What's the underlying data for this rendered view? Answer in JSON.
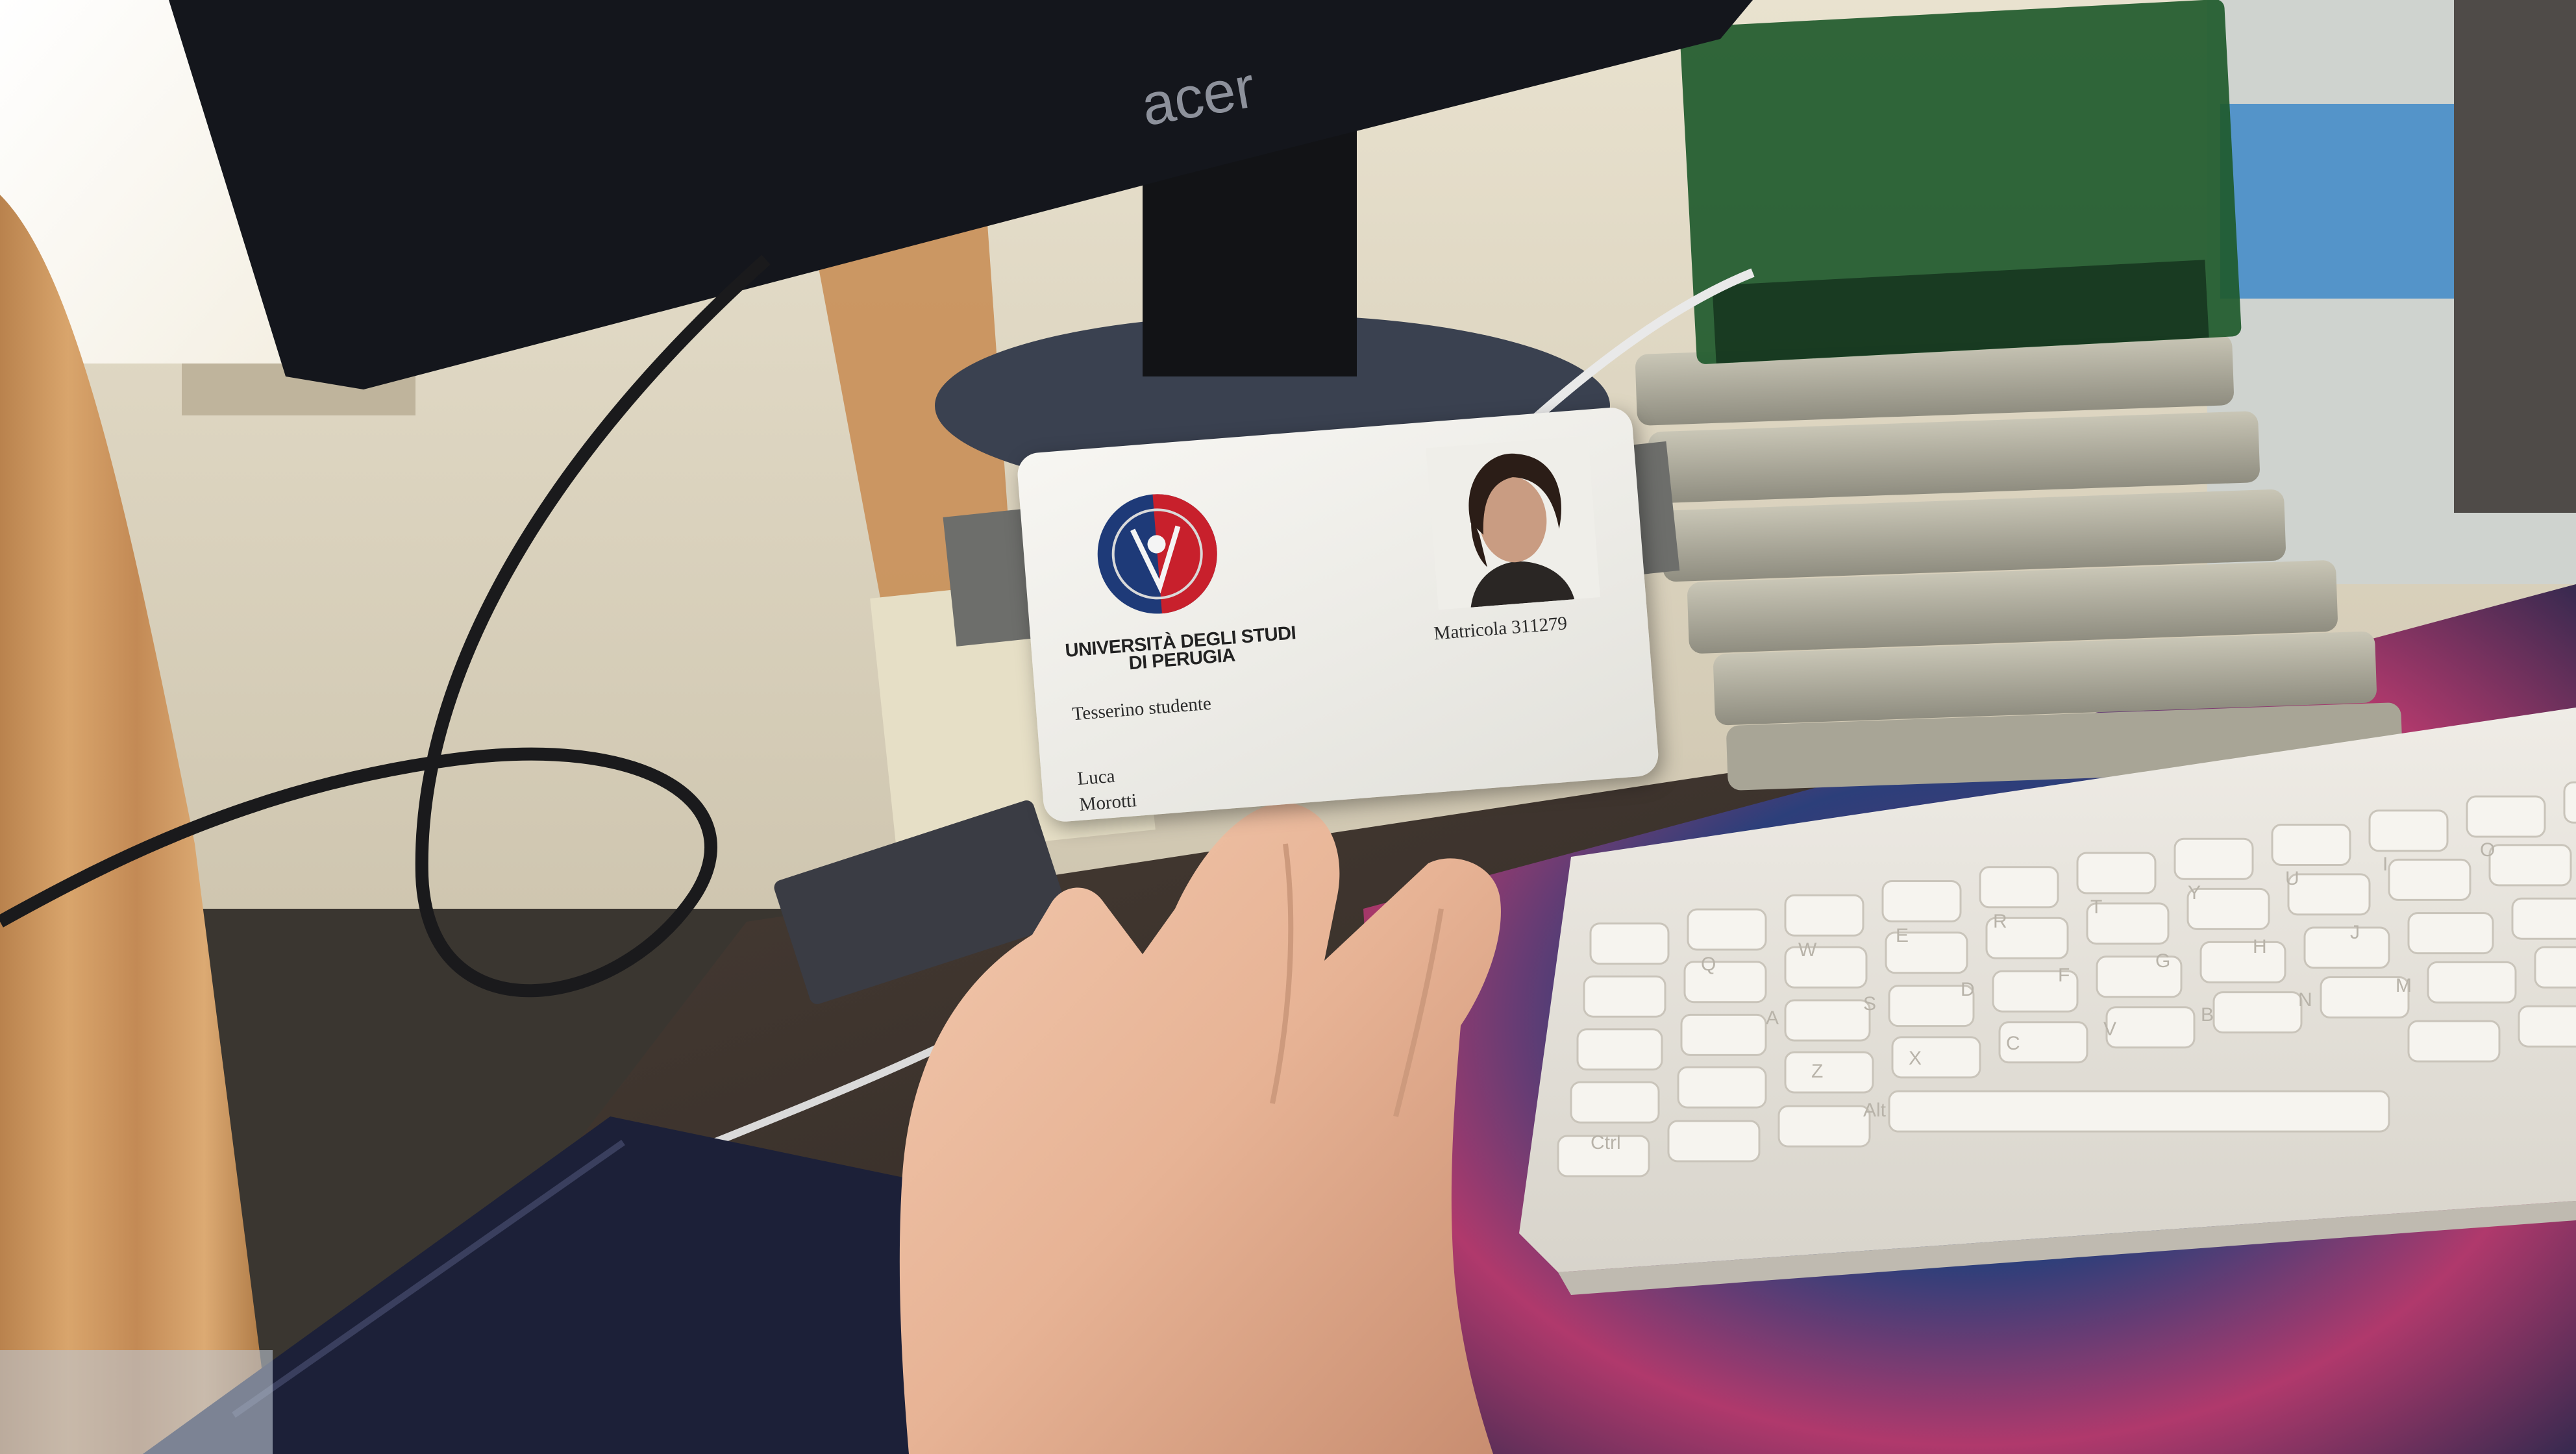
{
  "scene": {
    "monitor_brand": "acer",
    "keyboard_keys": [
      "Ctrl",
      "Alt",
      "A",
      "S",
      "D",
      "F",
      "G",
      "H",
      "J",
      "Z",
      "X",
      "C",
      "V",
      "B",
      "N",
      "M",
      "Q",
      "W",
      "E",
      "R",
      "T",
      "Y",
      "U",
      "I",
      "O"
    ]
  },
  "id_card": {
    "university_line1": "UNIVERSITÀ DEGLI STUDI",
    "university_line2": "DI PERUGIA",
    "card_type": "Tesserino studente",
    "student_number": "Matricola 311279",
    "first_name": "Luca",
    "last_name": "Morotti"
  },
  "colors": {
    "card": "#eeede8",
    "seal_blue": "#1e3a78",
    "seal_red": "#c8202c",
    "keyboard": "#e6e3dc",
    "monitor": "#14161c"
  }
}
